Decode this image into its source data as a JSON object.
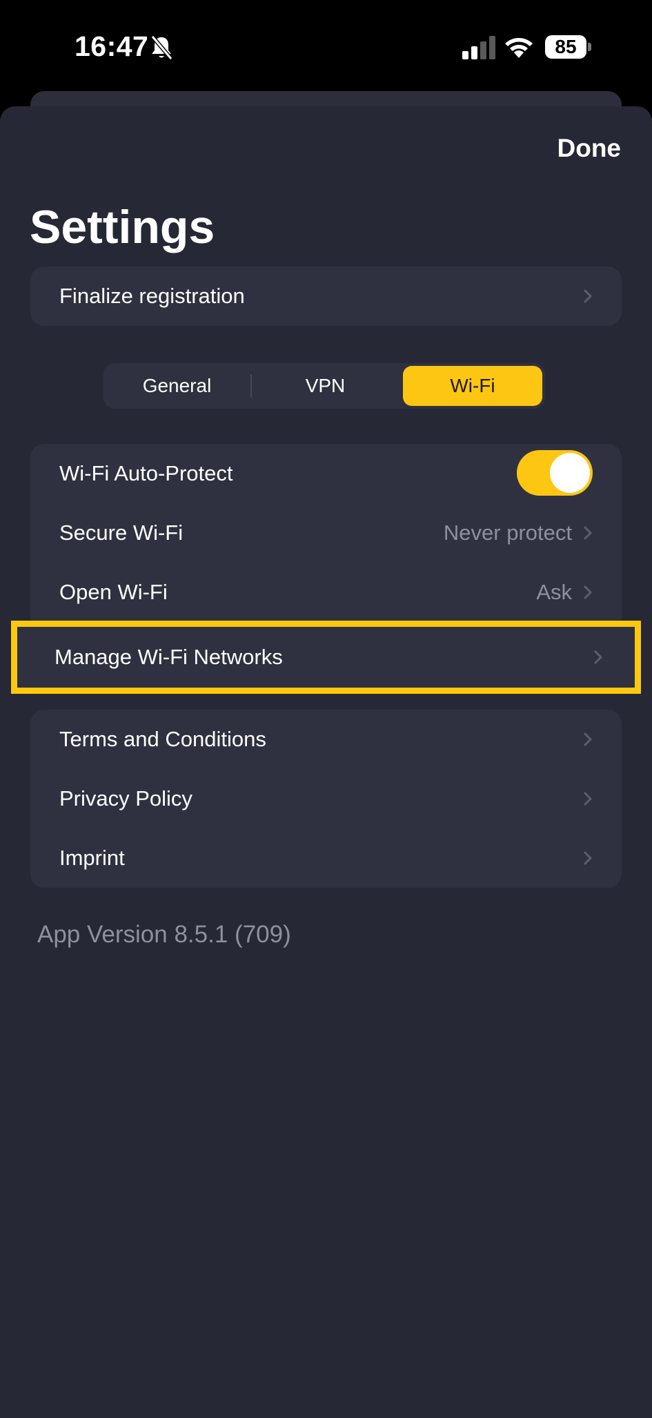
{
  "status_bar": {
    "time": "16:47",
    "battery": "85"
  },
  "header": {
    "done_label": "Done",
    "title": "Settings"
  },
  "registration": {
    "label": "Finalize registration"
  },
  "tabs": [
    {
      "label": "General",
      "active": false
    },
    {
      "label": "VPN",
      "active": false
    },
    {
      "label": "Wi-Fi",
      "active": true
    }
  ],
  "wifi_settings": {
    "auto_protect": {
      "label": "Wi-Fi Auto-Protect",
      "enabled": true
    },
    "secure_wifi": {
      "label": "Secure Wi-Fi",
      "value": "Never protect"
    },
    "open_wifi": {
      "label": "Open Wi-Fi",
      "value": "Ask"
    },
    "manage_networks": {
      "label": "Manage Wi-Fi Networks"
    }
  },
  "legal": {
    "terms": "Terms and Conditions",
    "privacy": "Privacy Policy",
    "imprint": "Imprint"
  },
  "footer": {
    "version": "App Version 8.5.1 (709)"
  },
  "colors": {
    "accent": "#fcc613",
    "background": "#262835",
    "card": "#2f3140",
    "secondary_text": "#8e909c"
  }
}
